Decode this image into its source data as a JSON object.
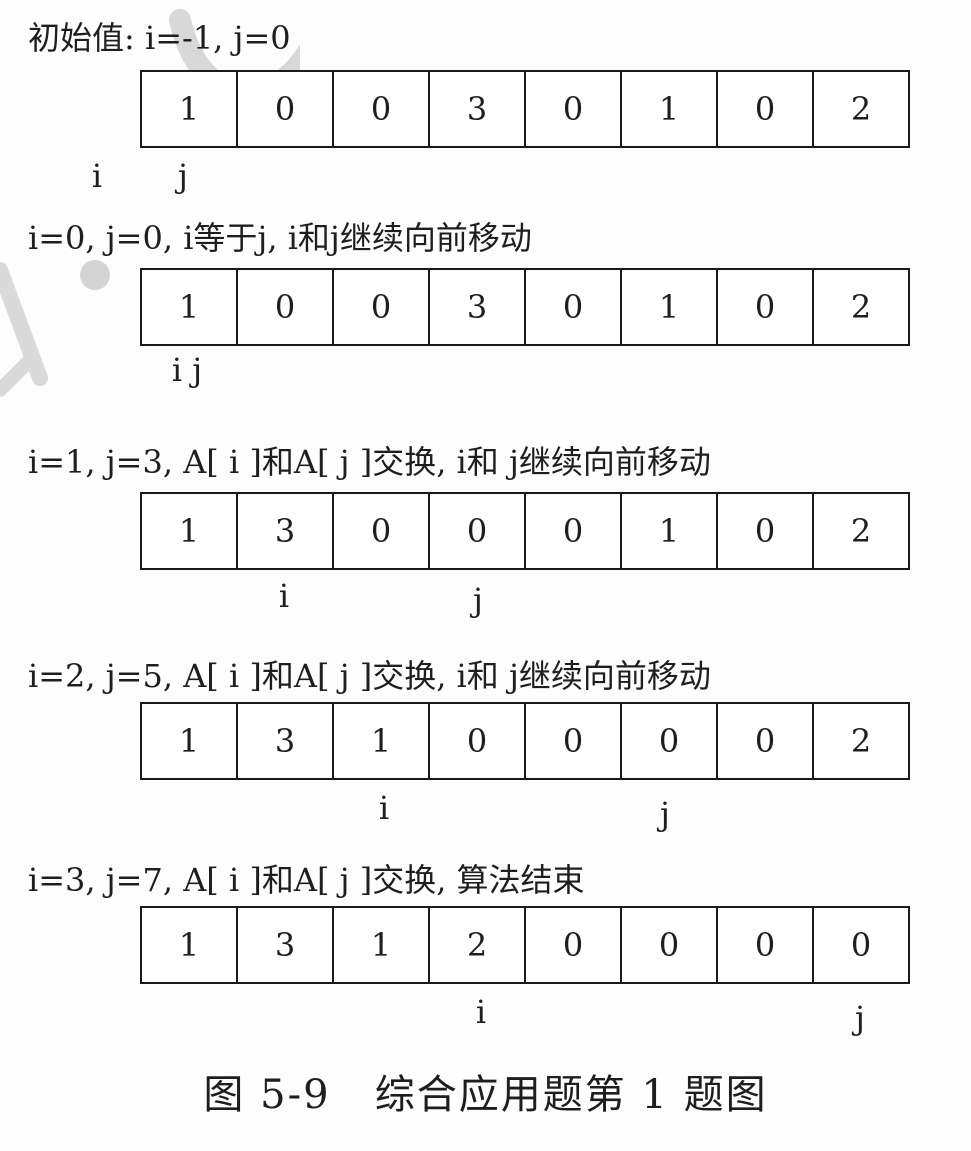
{
  "steps": [
    {
      "caption": "初始值: i=-1, j=0",
      "array": [
        "1",
        "0",
        "0",
        "3",
        "0",
        "1",
        "0",
        "2"
      ],
      "pointer_i": "i",
      "pointer_j": "j"
    },
    {
      "caption": "i=0, j=0, i等于j, i和j继续向前移动",
      "array": [
        "1",
        "0",
        "0",
        "3",
        "0",
        "1",
        "0",
        "2"
      ],
      "pointer_ij": "i j"
    },
    {
      "caption": "i=1, j=3, A[ i ]和A[ j ]交换, i和 j继续向前移动",
      "array": [
        "1",
        "3",
        "0",
        "0",
        "0",
        "1",
        "0",
        "2"
      ],
      "pointer_i": "i",
      "pointer_j": "j"
    },
    {
      "caption": "i=2, j=5, A[ i ]和A[ j ]交换, i和 j继续向前移动",
      "array": [
        "1",
        "3",
        "1",
        "0",
        "0",
        "0",
        "0",
        "2"
      ],
      "pointer_i": "i",
      "pointer_j": "j"
    },
    {
      "caption": "i=3, j=7, A[ i ]和A[ j ]交换, 算法结束",
      "array": [
        "1",
        "3",
        "1",
        "2",
        "0",
        "0",
        "0",
        "0"
      ],
      "pointer_i": "i",
      "pointer_j": "j"
    }
  ],
  "figure_caption": "图 5-9   综合应用题第 1 题图"
}
